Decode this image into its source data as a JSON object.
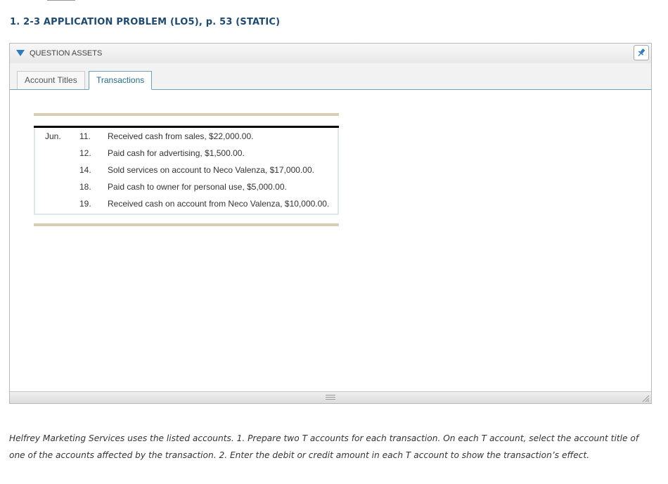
{
  "problem": {
    "title": "1. 2-3 APPLICATION PROBLEM (LO5), p. 53 (STATIC)"
  },
  "assets_panel": {
    "header_label": "QUESTION ASSETS",
    "tabs": [
      {
        "label": "Account Titles",
        "active": false
      },
      {
        "label": "Transactions",
        "active": true
      }
    ],
    "accent_color": "#2b7bbf"
  },
  "transactions": {
    "month": "Jun.",
    "rows": [
      {
        "day": "11.",
        "description": "Received cash from sales, $22,000.00."
      },
      {
        "day": "12.",
        "description": "Paid cash for advertising, $1,500.00."
      },
      {
        "day": "14.",
        "description": "Sold services on account to Neco Valenza, $17,000.00."
      },
      {
        "day": "18.",
        "description": "Paid cash to owner for personal use, $5,000.00."
      },
      {
        "day": "19.",
        "description": "Received cash on account from Neco Valenza, $10,000.00."
      }
    ]
  },
  "instructions": {
    "text": "Helfrey Marketing Services uses the listed accounts. 1. Prepare two T accounts for each transaction. On each T account, select the account title of one of the accounts affected by the transaction. 2. Enter the debit or credit amount in each T account to show the transaction’s effect."
  },
  "icons": {
    "collapse": "triangle-down-icon",
    "pin": "pin-icon",
    "drag": "drag-handle-icon",
    "resize": "resize-grip-icon"
  }
}
